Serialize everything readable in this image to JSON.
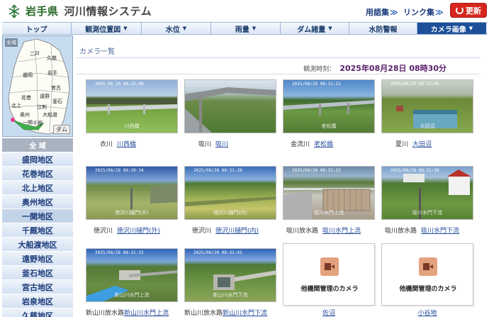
{
  "header": {
    "prefecture": "岩手県",
    "system": "河川情報システム",
    "link1": "用語集",
    "link2": "リンク集",
    "chev": "≫",
    "update": "更新"
  },
  "nav": [
    {
      "label": "トップ",
      "arrow": ""
    },
    {
      "label": "観測位置図",
      "arrow": "▼"
    },
    {
      "label": "水位",
      "arrow": "▼"
    },
    {
      "label": "雨量",
      "arrow": "▼"
    },
    {
      "label": "ダム諸量",
      "arrow": "▼"
    },
    {
      "label": "水防警報",
      "arrow": ""
    },
    {
      "label": "カメラ画像",
      "arrow": "▼"
    }
  ],
  "map": {
    "tag_top": "全域",
    "tag_bottom": "ダム",
    "labels": [
      "二戸",
      "久慈",
      "岩手",
      "盛岡",
      "宮古",
      "遠野",
      "花巻",
      "釜石",
      "北上",
      "奥州",
      "大船渡",
      "一関",
      "千厩",
      "江刺"
    ]
  },
  "areas": [
    "全 域",
    "盛岡地区",
    "花巻地区",
    "北上地区",
    "奥州地区",
    "一関地区",
    "千厩地区",
    "大船渡地区",
    "遠野地区",
    "釜石地区",
    "宮古地区",
    "岩泉地区",
    "久慈地区"
  ],
  "main": {
    "title": "カメラ一覧",
    "obs_label": "観測時刻：",
    "obs_value": "2025年08月28日 08時30分"
  },
  "cameras": [
    {
      "river": "衣川",
      "station": "川西橋",
      "ts": "2025_08_28  08:25:08",
      "wm": "川西橋"
    },
    {
      "river": "吸川",
      "station": "吸川",
      "ts": "",
      "wm": ""
    },
    {
      "river": "金流川",
      "station": "老松橋",
      "ts": "2025/08/28 08:31:23",
      "wm": "老松橋"
    },
    {
      "river": "夏川",
      "station": "大田沼",
      "ts": "2025/08/28 08:31:06",
      "wm": "大田沼"
    },
    {
      "river": "徳沢川",
      "station": "徳沢川樋門(外)",
      "ts": "2025/08/28 08:29:34",
      "wm": "徳沢川樋門(外)"
    },
    {
      "river": "徳沢川",
      "station": "徳沢川樋門(内)",
      "ts": "2025/08/28 08:31:28",
      "wm": "徳沢川樋門(内)"
    },
    {
      "river": "吸川放水路",
      "station": "吸川水門上流",
      "ts": "2025/08/28 08:31:23",
      "wm": "吸川水門上流"
    },
    {
      "river": "吸川放水路",
      "station": "吸川水門下流",
      "ts": "2025/08/28 08:31:38",
      "wm": "吸川水門下流"
    },
    {
      "river": "新山川放水路",
      "station": "新山川水門上流",
      "ts": "2025/08/28 08:31:33",
      "wm": "新山川水門上流"
    },
    {
      "river": "新山川放水路",
      "station": "新山川水門下流",
      "ts": "2025/08/28 08:31:42",
      "wm": "新山川水門下流"
    }
  ],
  "others": [
    {
      "label": "他機関管理のカメラ",
      "link": "佐沼"
    },
    {
      "label": "他機関管理のカメラ",
      "link": "小谷地"
    }
  ],
  "colors": {
    "accent": "#1d4f9a",
    "update": "#d6271f",
    "time": "#5a1f6a"
  }
}
